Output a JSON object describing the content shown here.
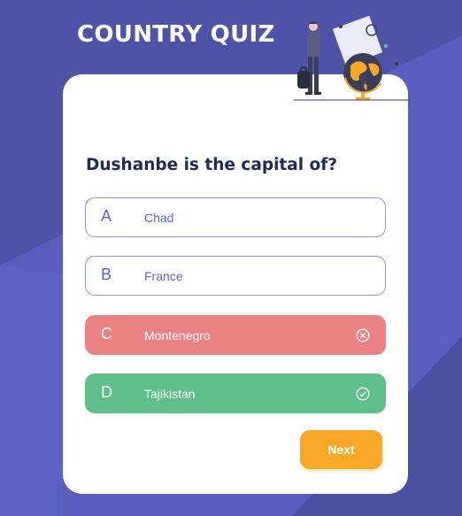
{
  "app": {
    "title": "COUNTRY QUIZ"
  },
  "question": {
    "text": "Dushanbe is the capital of?"
  },
  "options": [
    {
      "letter": "A",
      "text": "Chad",
      "state": "default"
    },
    {
      "letter": "B",
      "text": "France",
      "state": "default"
    },
    {
      "letter": "C",
      "text": "Montenegro",
      "state": "wrong",
      "status_icon": "close-circle-icon"
    },
    {
      "letter": "D",
      "text": "Tajikistan",
      "state": "correct",
      "status_icon": "check-circle-icon"
    }
  ],
  "actions": {
    "next_label": "Next"
  },
  "colors": {
    "background": "#5a5fbf",
    "card": "#ffffff",
    "accent": "#6066d0",
    "wrong": "#ea8282",
    "correct": "#60bf88",
    "button": "#f9a826",
    "question_text": "#1f2a55"
  },
  "illustration": {
    "icon": "traveler-globe-illustration"
  }
}
